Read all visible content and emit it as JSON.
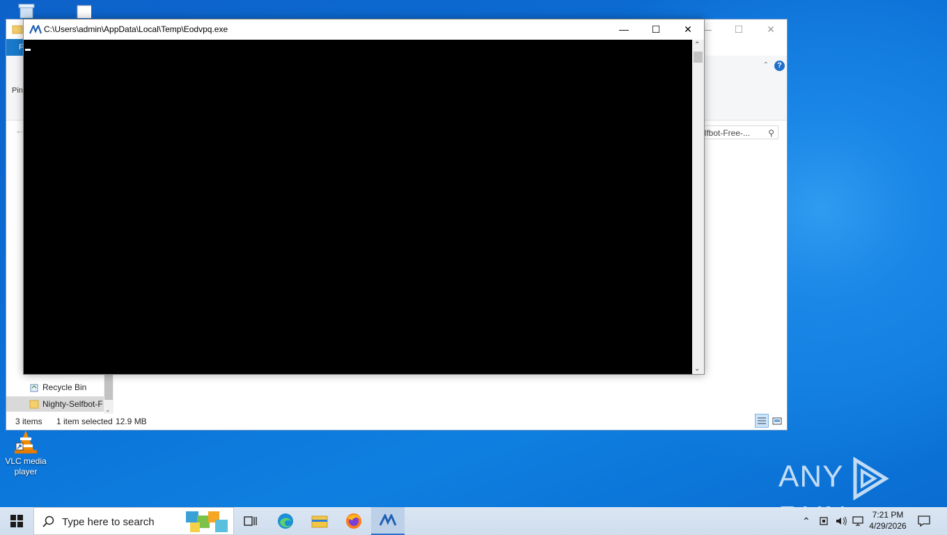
{
  "desktop": {
    "icons": [
      {
        "label": "VLC media player"
      }
    ],
    "watermark_left": "ANY",
    "watermark_right": "RUN"
  },
  "explorer": {
    "ribbon_tab": "F",
    "ribbon_pin_label": "Pin",
    "search_text": "elfbot-Free-...",
    "nav_items": [
      {
        "label": "Recycle Bin"
      },
      {
        "label": "Nighty-Selfbot-F"
      }
    ],
    "status": {
      "items": "3 items",
      "selected": "1 item selected",
      "size": "12.9 MB"
    }
  },
  "console": {
    "title": "C:\\Users\\admin\\AppData\\Local\\Temp\\Eodvpq.exe"
  },
  "taskbar": {
    "search_placeholder": "Type here to search",
    "clock_time": "7:21 PM",
    "clock_date": "4/29/2026"
  }
}
